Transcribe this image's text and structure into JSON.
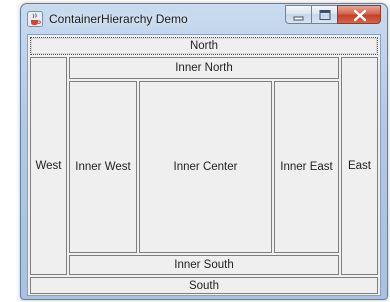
{
  "window": {
    "title": "ContainerHierarchy Demo",
    "icon": "java-cup-icon",
    "controls": [
      "minimize-icon",
      "maximize-icon",
      "close-icon"
    ]
  },
  "regions": {
    "north": "North",
    "south": "South",
    "west": "West",
    "east": "East",
    "inner_north": "Inner North",
    "inner_south": "Inner South",
    "inner_west": "Inner West",
    "inner_east": "Inner East",
    "inner_center": "Inner Center"
  },
  "colors": {
    "titlebar": "#b3c9e4",
    "close_button": "#c24128",
    "panel": "#efefef"
  }
}
